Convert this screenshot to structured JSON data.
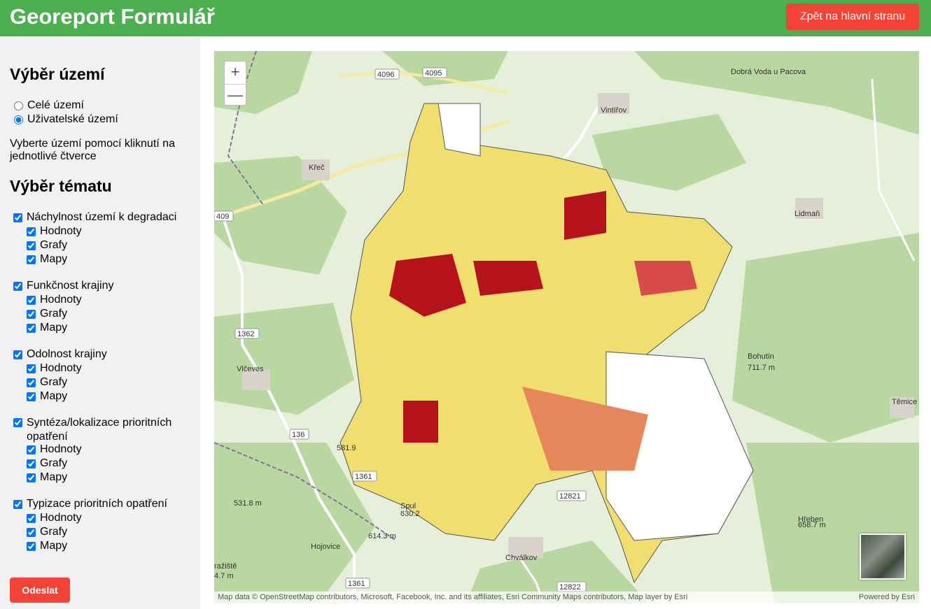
{
  "header": {
    "title": "Georeport Formulář",
    "back_label": "Zpět na hlavní stranu"
  },
  "sidebar": {
    "area_heading": "Výběr území",
    "area_options": [
      {
        "label": "Celé území",
        "checked": false
      },
      {
        "label": "Uživatelské území",
        "checked": true
      }
    ],
    "hint": "Vyberte území pomocí kliknutí na jednotlivé čtverce",
    "topic_heading": "Výběr tématu",
    "topics": [
      {
        "label": "Náchylnost území k degradaci",
        "subs": [
          "Hodnoty",
          "Grafy",
          "Mapy"
        ]
      },
      {
        "label": "Funkčnost krajiny",
        "subs": [
          "Hodnoty",
          "Grafy",
          "Mapy"
        ]
      },
      {
        "label": "Odolnost krajiny",
        "subs": [
          "Hodnoty",
          "Grafy",
          "Mapy"
        ]
      },
      {
        "label": "Syntéza/lokalizace prioritních opatření",
        "subs": [
          "Hodnoty",
          "Grafy",
          "Mapy"
        ]
      },
      {
        "label": "Typizace prioritních opatření",
        "subs": [
          "Hodnoty",
          "Grafy",
          "Mapy"
        ]
      }
    ],
    "submit_label": "Odeslat"
  },
  "map": {
    "zoom_in": "+",
    "zoom_out": "—",
    "attribution": "Map data © OpenStreetMap contributors, Microsoft, Facebook, Inc. and its affiliates, Esri Community Maps contributors, Map layer by Esri",
    "powered_by": "Powered by Esri",
    "places": [
      "Dobrá Voda u Pacova",
      "Vintířov",
      "Křeč",
      "Lidmaň",
      "Bohutín",
      "711.7 m",
      "Těmice",
      "Vlčeves",
      "581.9",
      "531.8 m",
      "Spul",
      "630.2",
      "614.3 m",
      "Hojovice",
      "Chválkov",
      "Hřeben",
      "658.7 m",
      "ražiště",
      "4.7 m"
    ],
    "road_labels": [
      "4096",
      "4095",
      "409",
      "1362",
      "136",
      "1361",
      "12821",
      "1361",
      "12822"
    ],
    "category_colors": {
      "0": "#ffffff",
      "1": "#fff8b0",
      "2": "#f0df6e",
      "3": "#c8860a",
      "pink": "#f7b5b5",
      "orange": "#e5875a",
      "red": "#b5121b"
    }
  }
}
